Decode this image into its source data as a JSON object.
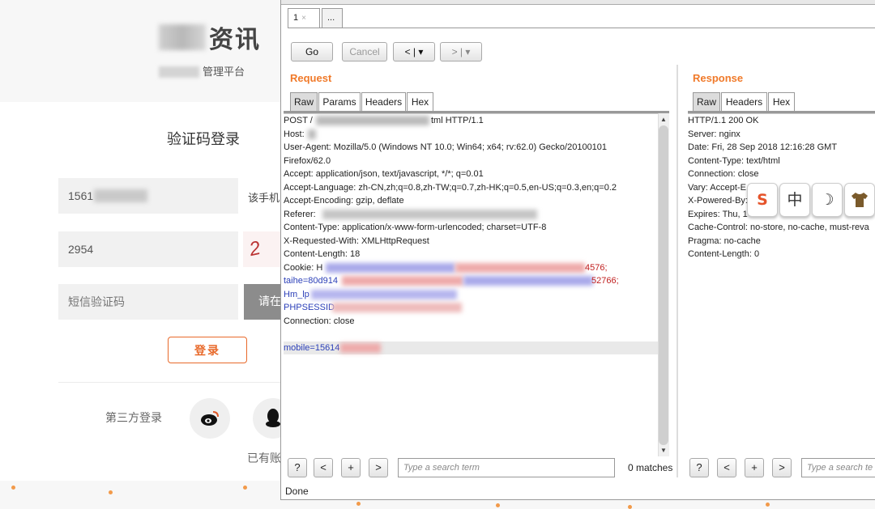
{
  "login_page": {
    "logo_title": "资讯",
    "logo_subtitle": "管理平台",
    "card_title": "验证码登录",
    "phone_value": "1561",
    "phone_side_text": "该手机",
    "captcha_input_value": "2954",
    "captcha_image_text": "2",
    "sms_placeholder": "短信验证码",
    "sms_button_label": "请在",
    "login_button": "登录",
    "third_party_label": "第三方登录",
    "weibo_icon": "weibo-icon",
    "qq_icon": "qq-icon",
    "have_account_text": "已有账",
    "accent_color": "#e8692a"
  },
  "burp": {
    "tabs": [
      {
        "label": "1",
        "close": "×"
      },
      {
        "label": "..."
      }
    ],
    "toolbar": {
      "go": "Go",
      "cancel": "Cancel",
      "back": "<",
      "forward": ">"
    },
    "request": {
      "label": "Request",
      "tabs": [
        "Raw",
        "Params",
        "Headers",
        "Hex"
      ],
      "active_tab": "Raw",
      "lines": {
        "l1a": "POST /",
        "l1b": "tml HTTP/1.1",
        "l2": "Host:",
        "l3": "User-Agent: Mozilla/5.0 (Windows NT 10.0; Win64; x64; rv:62.0) Gecko/20100101",
        "l4": "Firefox/62.0",
        "l5": "Accept: application/json, text/javascript, */*; q=0.01",
        "l6": "Accept-Language: zh-CN,zh;q=0.8,zh-TW;q=0.7,zh-HK;q=0.5,en-US;q=0.3,en;q=0.2",
        "l7": "Accept-Encoding: gzip, deflate",
        "l8": "Referer:",
        "l9": "Content-Type: application/x-www-form-urlencoded; charset=UTF-8",
        "l10": "X-Requested-With: XMLHttpRequest",
        "l11": "Content-Length: 18",
        "l12a": "Cookie: H",
        "l12b": "4576;",
        "l13a": "taihe=80d914",
        "l13b": "52766;",
        "l14": "Hm_lp",
        "l15": "PHPSESSID",
        "l16": "Connection: close",
        "l17": "",
        "l18": "mobile=15614"
      }
    },
    "response": {
      "label": "Response",
      "tabs": [
        "Raw",
        "Headers",
        "Hex"
      ],
      "active_tab": "Raw",
      "lines": [
        "HTTP/1.1 200 OK",
        "Server: nginx",
        "Date: Fri, 28 Sep 2018 12:16:28 GMT",
        "Content-Type: text/html",
        "Connection: close",
        "Vary: Accept-E",
        "X-Powered-By:",
        "Expires: Thu, 1",
        "Cache-Control: no-store, no-cache, must-reva",
        "Pragma: no-cache",
        "Content-Length: 0"
      ]
    },
    "search": {
      "help": "?",
      "prev": "<",
      "add": "+",
      "next": ">",
      "placeholder": "Type a search term",
      "placeholder_short": "Type a search te",
      "matches": "0 matches"
    },
    "status": "Done"
  },
  "ime_toolbar": {
    "logo": "S",
    "mode": "中",
    "moon_icon": "☽",
    "skin_icon": "shirt-icon"
  }
}
